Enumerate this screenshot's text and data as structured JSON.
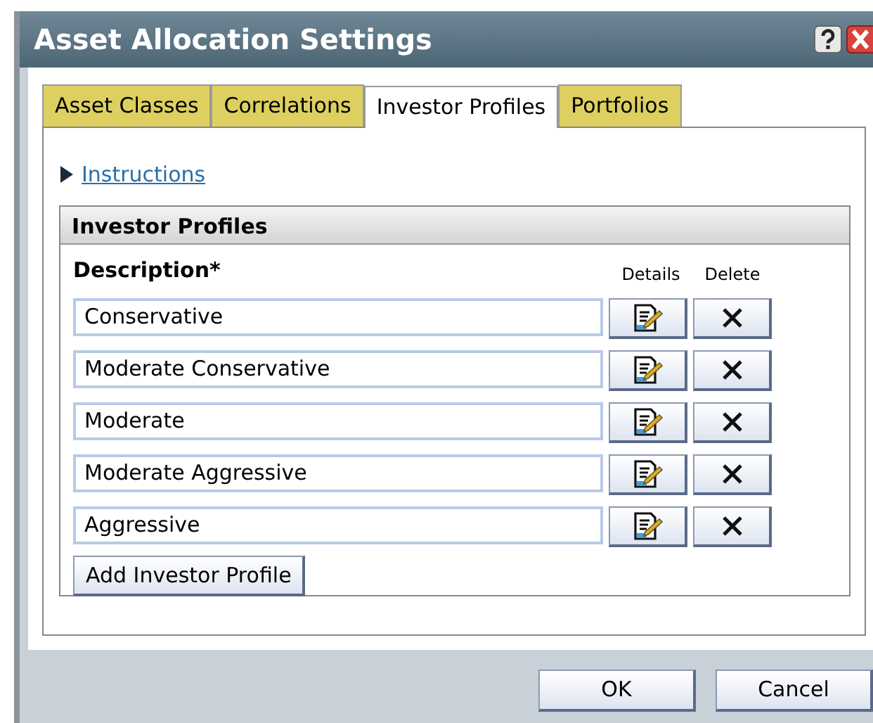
{
  "window": {
    "title": "Asset Allocation Settings"
  },
  "tabs": [
    {
      "label": "Asset Classes",
      "selected": false
    },
    {
      "label": "Correlations",
      "selected": false
    },
    {
      "label": "Investor Profiles",
      "selected": true
    },
    {
      "label": "Portfolios",
      "selected": false
    }
  ],
  "instructions": {
    "label": "Instructions",
    "expanded": false
  },
  "group": {
    "title": "Investor Profiles",
    "description_label": "Description*",
    "details_label": "Details",
    "delete_label": "Delete",
    "profiles": [
      {
        "value": "Conservative"
      },
      {
        "value": "Moderate Conservative"
      },
      {
        "value": "Moderate"
      },
      {
        "value": "Moderate Aggressive"
      },
      {
        "value": "Aggressive"
      }
    ],
    "add_button": "Add Investor Profile"
  },
  "buttons": [
    "OK",
    "Cancel"
  ]
}
